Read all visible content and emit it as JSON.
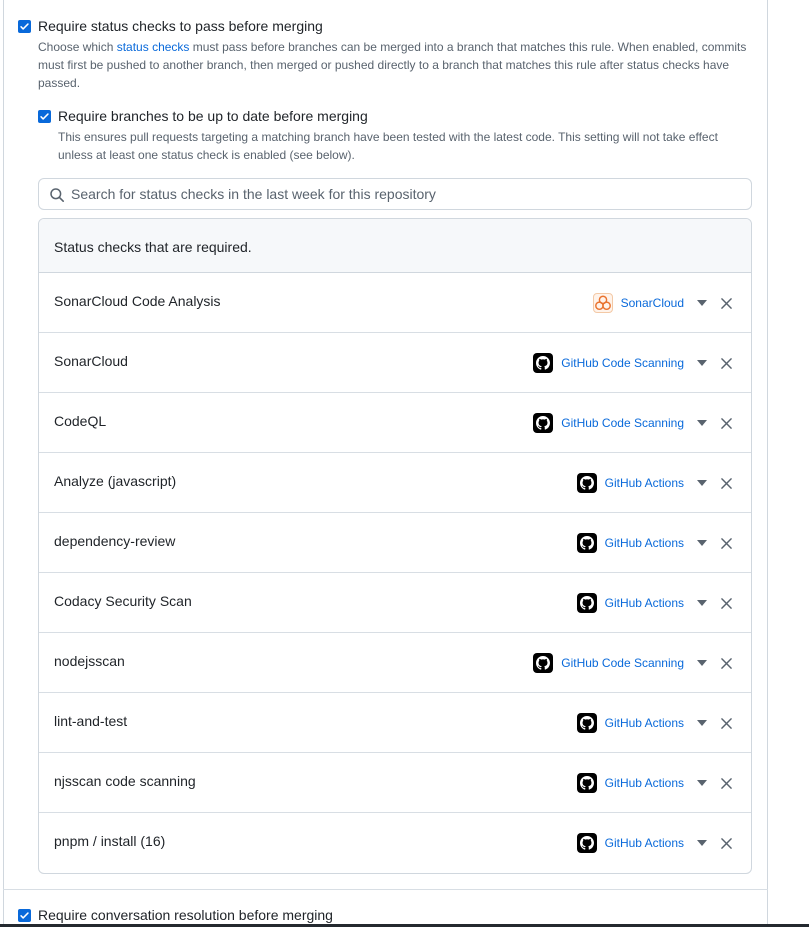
{
  "settings": {
    "status_checks": {
      "label": "Require status checks to pass before merging",
      "desc_before": "Choose which ",
      "desc_link": "status checks",
      "desc_after": " must pass before branches can be merged into a branch that matches this rule. When enabled, commits must first be pushed to another branch, then merged or pushed directly to a branch that matches this rule after status checks have passed.",
      "checked": true
    },
    "up_to_date": {
      "label": "Require branches to be up to date before merging",
      "desc": "This ensures pull requests targeting a matching branch have been tested with the latest code. This setting will not take effect unless at least one status check is enabled (see below).",
      "checked": true
    },
    "search": {
      "placeholder": "Search for status checks in the last week for this repository",
      "value": ""
    },
    "required": {
      "header": "Status checks that are required.",
      "checks": [
        {
          "name": "SonarCloud Code Analysis",
          "app": "SonarCloud",
          "icon": "sonarcloud-icon"
        },
        {
          "name": "SonarCloud",
          "app": "GitHub Code Scanning",
          "icon": "github-icon"
        },
        {
          "name": "CodeQL",
          "app": "GitHub Code Scanning",
          "icon": "github-icon"
        },
        {
          "name": "Analyze (javascript)",
          "app": "GitHub Actions",
          "icon": "github-icon"
        },
        {
          "name": "dependency-review",
          "app": "GitHub Actions",
          "icon": "github-icon"
        },
        {
          "name": "Codacy Security Scan",
          "app": "GitHub Actions",
          "icon": "github-icon"
        },
        {
          "name": "nodejsscan",
          "app": "GitHub Code Scanning",
          "icon": "github-icon"
        },
        {
          "name": "lint-and-test",
          "app": "GitHub Actions",
          "icon": "github-icon"
        },
        {
          "name": "njsscan code scanning",
          "app": "GitHub Actions",
          "icon": "github-icon"
        },
        {
          "name": "pnpm / install (16)",
          "app": "GitHub Actions",
          "icon": "github-icon"
        }
      ]
    },
    "conversation_resolution": {
      "label": "Require conversation resolution before merging",
      "checked": true
    }
  },
  "colors": {
    "accent": "#0969da",
    "text": "#1f2328",
    "muted": "#59636e",
    "border": "#d0d7de",
    "header_bg": "#f6f8fa"
  }
}
